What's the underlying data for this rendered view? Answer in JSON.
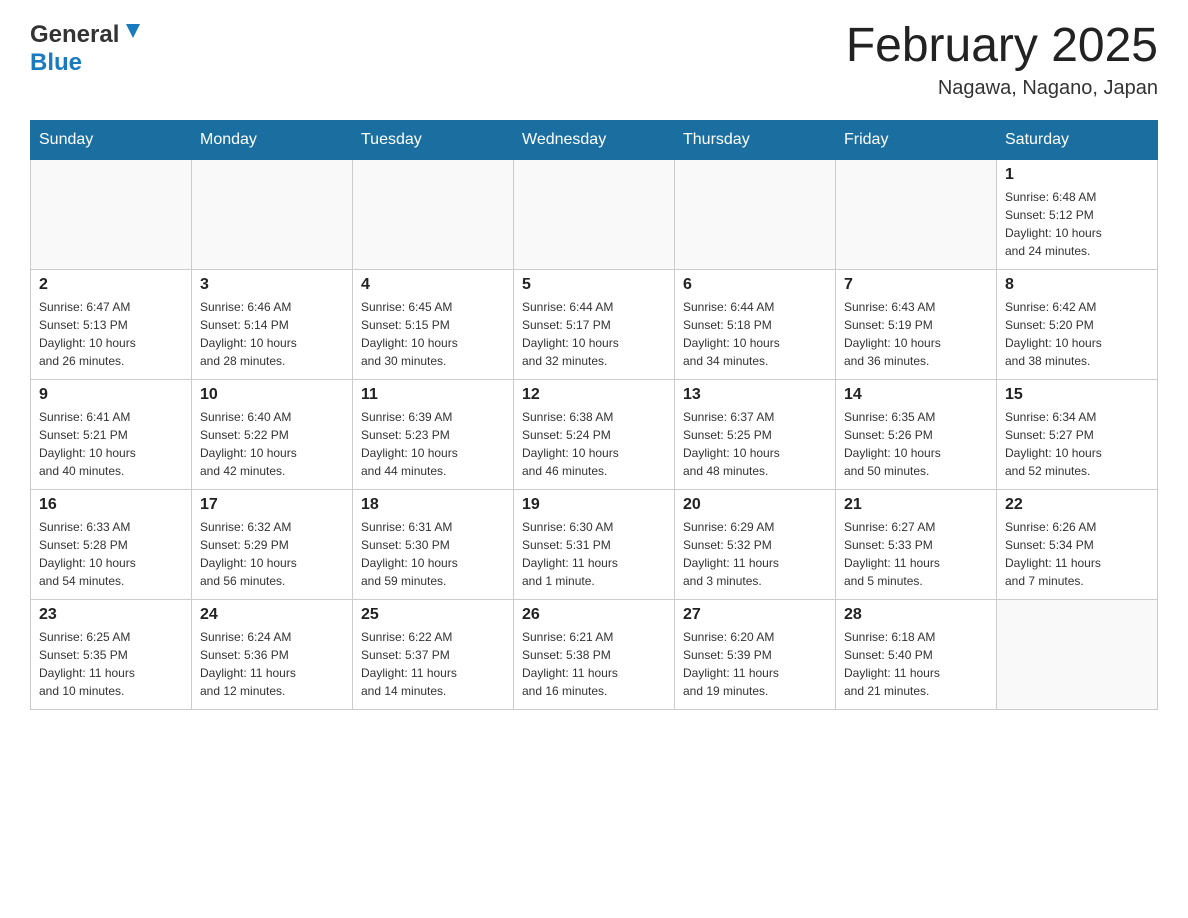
{
  "header": {
    "logo": {
      "general": "General",
      "blue": "Blue",
      "line1": "General",
      "line2": "Blue"
    },
    "title": "February 2025",
    "location": "Nagawa, Nagano, Japan"
  },
  "weekdays": [
    "Sunday",
    "Monday",
    "Tuesday",
    "Wednesday",
    "Thursday",
    "Friday",
    "Saturday"
  ],
  "weeks": [
    [
      {
        "day": "",
        "info": ""
      },
      {
        "day": "",
        "info": ""
      },
      {
        "day": "",
        "info": ""
      },
      {
        "day": "",
        "info": ""
      },
      {
        "day": "",
        "info": ""
      },
      {
        "day": "",
        "info": ""
      },
      {
        "day": "1",
        "info": "Sunrise: 6:48 AM\nSunset: 5:12 PM\nDaylight: 10 hours\nand 24 minutes."
      }
    ],
    [
      {
        "day": "2",
        "info": "Sunrise: 6:47 AM\nSunset: 5:13 PM\nDaylight: 10 hours\nand 26 minutes."
      },
      {
        "day": "3",
        "info": "Sunrise: 6:46 AM\nSunset: 5:14 PM\nDaylight: 10 hours\nand 28 minutes."
      },
      {
        "day": "4",
        "info": "Sunrise: 6:45 AM\nSunset: 5:15 PM\nDaylight: 10 hours\nand 30 minutes."
      },
      {
        "day": "5",
        "info": "Sunrise: 6:44 AM\nSunset: 5:17 PM\nDaylight: 10 hours\nand 32 minutes."
      },
      {
        "day": "6",
        "info": "Sunrise: 6:44 AM\nSunset: 5:18 PM\nDaylight: 10 hours\nand 34 minutes."
      },
      {
        "day": "7",
        "info": "Sunrise: 6:43 AM\nSunset: 5:19 PM\nDaylight: 10 hours\nand 36 minutes."
      },
      {
        "day": "8",
        "info": "Sunrise: 6:42 AM\nSunset: 5:20 PM\nDaylight: 10 hours\nand 38 minutes."
      }
    ],
    [
      {
        "day": "9",
        "info": "Sunrise: 6:41 AM\nSunset: 5:21 PM\nDaylight: 10 hours\nand 40 minutes."
      },
      {
        "day": "10",
        "info": "Sunrise: 6:40 AM\nSunset: 5:22 PM\nDaylight: 10 hours\nand 42 minutes."
      },
      {
        "day": "11",
        "info": "Sunrise: 6:39 AM\nSunset: 5:23 PM\nDaylight: 10 hours\nand 44 minutes."
      },
      {
        "day": "12",
        "info": "Sunrise: 6:38 AM\nSunset: 5:24 PM\nDaylight: 10 hours\nand 46 minutes."
      },
      {
        "day": "13",
        "info": "Sunrise: 6:37 AM\nSunset: 5:25 PM\nDaylight: 10 hours\nand 48 minutes."
      },
      {
        "day": "14",
        "info": "Sunrise: 6:35 AM\nSunset: 5:26 PM\nDaylight: 10 hours\nand 50 minutes."
      },
      {
        "day": "15",
        "info": "Sunrise: 6:34 AM\nSunset: 5:27 PM\nDaylight: 10 hours\nand 52 minutes."
      }
    ],
    [
      {
        "day": "16",
        "info": "Sunrise: 6:33 AM\nSunset: 5:28 PM\nDaylight: 10 hours\nand 54 minutes."
      },
      {
        "day": "17",
        "info": "Sunrise: 6:32 AM\nSunset: 5:29 PM\nDaylight: 10 hours\nand 56 minutes."
      },
      {
        "day": "18",
        "info": "Sunrise: 6:31 AM\nSunset: 5:30 PM\nDaylight: 10 hours\nand 59 minutes."
      },
      {
        "day": "19",
        "info": "Sunrise: 6:30 AM\nSunset: 5:31 PM\nDaylight: 11 hours\nand 1 minute."
      },
      {
        "day": "20",
        "info": "Sunrise: 6:29 AM\nSunset: 5:32 PM\nDaylight: 11 hours\nand 3 minutes."
      },
      {
        "day": "21",
        "info": "Sunrise: 6:27 AM\nSunset: 5:33 PM\nDaylight: 11 hours\nand 5 minutes."
      },
      {
        "day": "22",
        "info": "Sunrise: 6:26 AM\nSunset: 5:34 PM\nDaylight: 11 hours\nand 7 minutes."
      }
    ],
    [
      {
        "day": "23",
        "info": "Sunrise: 6:25 AM\nSunset: 5:35 PM\nDaylight: 11 hours\nand 10 minutes."
      },
      {
        "day": "24",
        "info": "Sunrise: 6:24 AM\nSunset: 5:36 PM\nDaylight: 11 hours\nand 12 minutes."
      },
      {
        "day": "25",
        "info": "Sunrise: 6:22 AM\nSunset: 5:37 PM\nDaylight: 11 hours\nand 14 minutes."
      },
      {
        "day": "26",
        "info": "Sunrise: 6:21 AM\nSunset: 5:38 PM\nDaylight: 11 hours\nand 16 minutes."
      },
      {
        "day": "27",
        "info": "Sunrise: 6:20 AM\nSunset: 5:39 PM\nDaylight: 11 hours\nand 19 minutes."
      },
      {
        "day": "28",
        "info": "Sunrise: 6:18 AM\nSunset: 5:40 PM\nDaylight: 11 hours\nand 21 minutes."
      },
      {
        "day": "",
        "info": ""
      }
    ]
  ],
  "colors": {
    "header_bg": "#1a6fa0",
    "border": "#cccccc",
    "empty_bg": "#f9f9f9"
  }
}
